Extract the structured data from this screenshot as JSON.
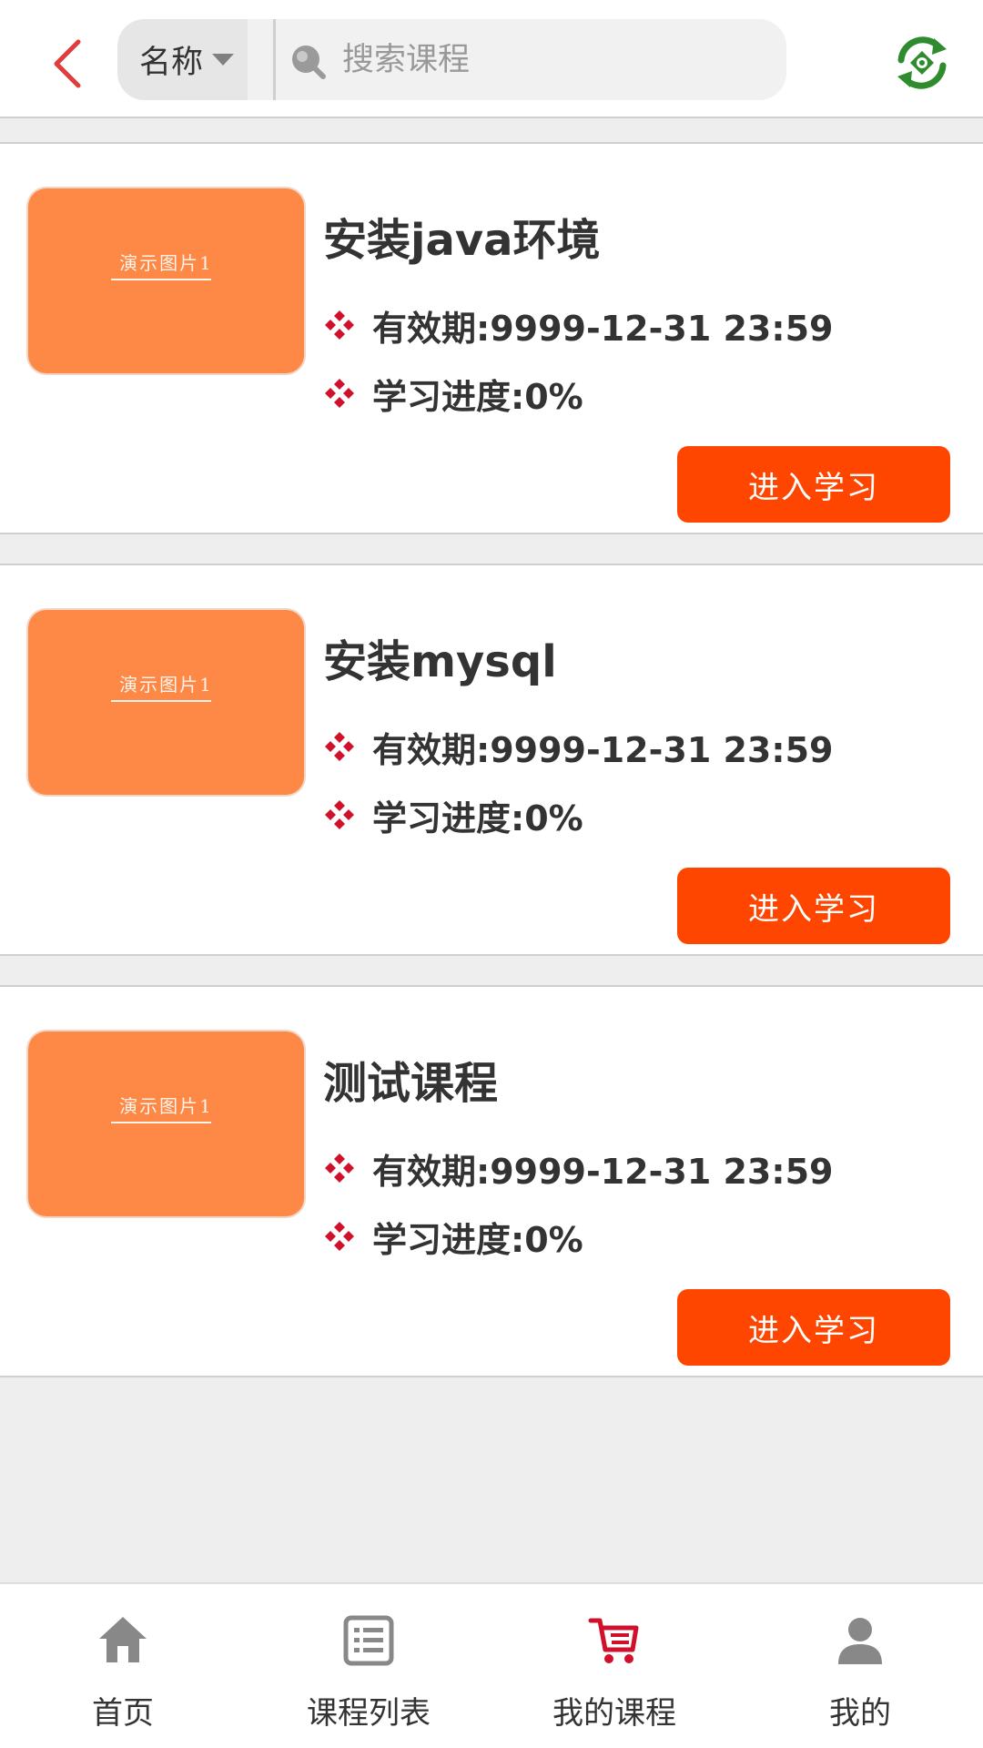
{
  "header": {
    "search_type": "名称",
    "search_placeholder": "搜索课程",
    "search_value": ""
  },
  "colors": {
    "accent": "#ff4600",
    "thumbnail": "#fe8845",
    "refresh": "#2e8b2e",
    "bullet": "#d0112b",
    "back": "#e03c3c",
    "nav_active": "#d0112b",
    "nav_inactive": "#888888"
  },
  "courses": [
    {
      "thumbnail_text": "演示图片1",
      "title": "安装java环境",
      "expiry": "有效期:9999-12-31  23:59",
      "progress": "学习进度:0%",
      "button": "进入学习"
    },
    {
      "thumbnail_text": "演示图片1",
      "title": "安装mysql",
      "expiry": "有效期:9999-12-31  23:59",
      "progress": "学习进度:0%",
      "button": "进入学习"
    },
    {
      "thumbnail_text": "演示图片1",
      "title": "测试课程",
      "expiry": "有效期:9999-12-31  23:59",
      "progress": "学习进度:0%",
      "button": "进入学习"
    }
  ],
  "nav": {
    "items": [
      {
        "label": "首页",
        "icon": "home-icon"
      },
      {
        "label": "课程列表",
        "icon": "list-icon"
      },
      {
        "label": "我的课程",
        "icon": "cart-icon",
        "active": true
      },
      {
        "label": "我的",
        "icon": "user-icon"
      }
    ]
  }
}
